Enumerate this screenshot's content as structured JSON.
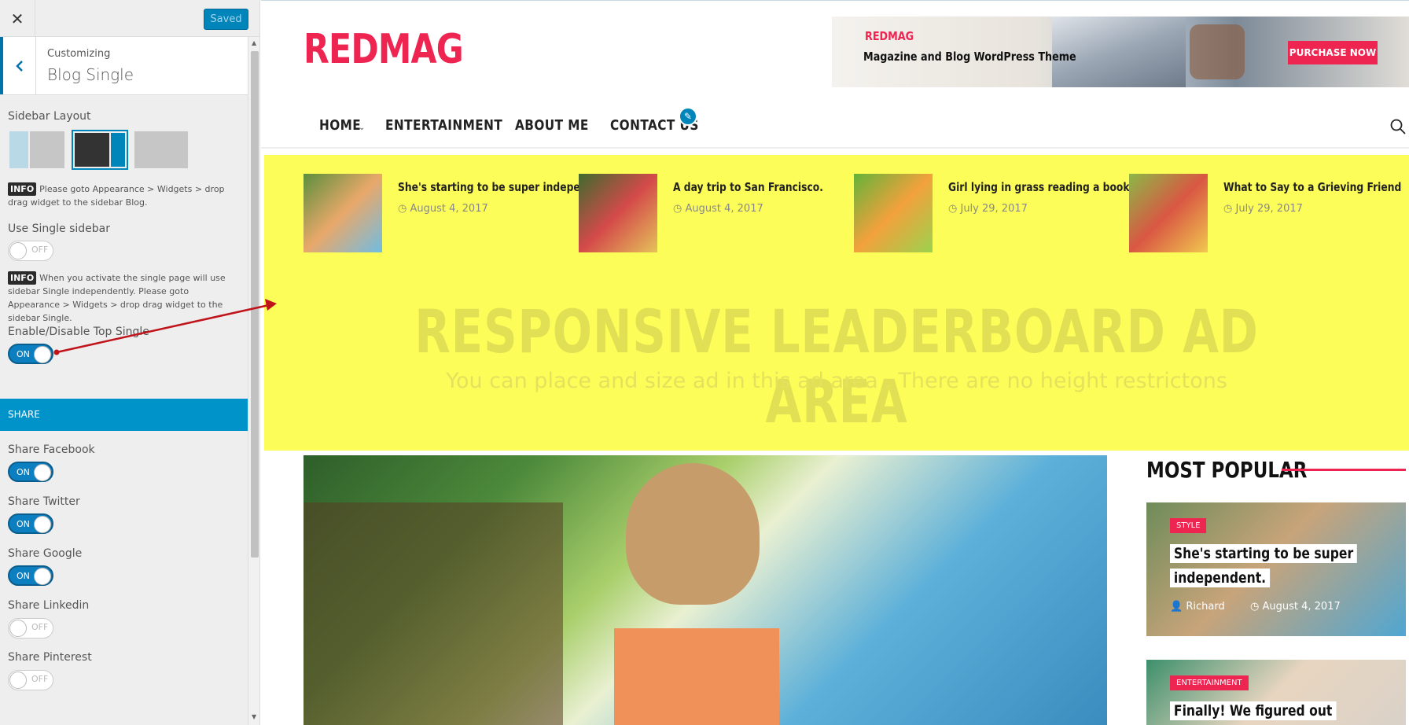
{
  "customizer": {
    "close_glyph": "✕",
    "saved_label": "Saved",
    "header_sup": "Customizing",
    "header_title": "Blog Single",
    "sidebar_layout_label": "Sidebar Layout",
    "info_badge": "INFO",
    "info1": "Please goto Appearance > Widgets > drop drag widget to the sidebar Blog.",
    "use_single_sidebar_label": "Use Single sidebar",
    "info2": "When you activate the single page will use sidebar Single independently. Please goto Appearance > Widgets > drop drag widget to the sidebar Single.",
    "top_single_label": "Enable/Disable Top Single",
    "share_section": "SHARE",
    "toggle_on": "ON",
    "toggle_off": "OFF",
    "toggles": [
      {
        "label": "Use Single sidebar",
        "state": "off"
      },
      {
        "label": "Enable/Disable Top Single",
        "state": "on"
      },
      {
        "label": "Share Facebook",
        "state": "on"
      },
      {
        "label": "Share Twitter",
        "state": "on"
      },
      {
        "label": "Share Google",
        "state": "on"
      },
      {
        "label": "Share Linkedin",
        "state": "off"
      },
      {
        "label": "Share Pinterest",
        "state": "off"
      }
    ],
    "accent_color": "#0085ba"
  },
  "site": {
    "logo": "REDMAG",
    "banner": {
      "brand": "REDMAG",
      "tagline": "Magazine and Blog WordPress Theme",
      "button": "PURCHASE NOW"
    },
    "nav": [
      "HOME",
      "ENTERTAINMENT",
      "ABOUT ME",
      "CONTACT US"
    ],
    "top_posts": [
      {
        "title": "She's starting to be super independent.",
        "date": "August 4, 2017"
      },
      {
        "title": "A day trip to San Francisco.",
        "date": "August 4, 2017"
      },
      {
        "title": "Girl lying in grass reading a book",
        "date": "July 29, 2017"
      },
      {
        "title": "What to Say to a Grieving Friend",
        "date": "July 29, 2017"
      }
    ],
    "ad_title": "RESPONSIVE LEADERBOARD AD  AREA",
    "ad_sub": "You can place and size ad in this ad area . There are no height restrictons",
    "popular": {
      "title": "MOST POPULAR",
      "cards": [
        {
          "badge": "STYLE",
          "title": "She's starting to be super independent.",
          "author": "Richard",
          "date": "August 4, 2017"
        },
        {
          "badge": "ENTERTAINMENT",
          "title": "Finally! We figured out"
        }
      ]
    },
    "brand_color": "#ee2451",
    "ad_color": "#fdfd59"
  }
}
